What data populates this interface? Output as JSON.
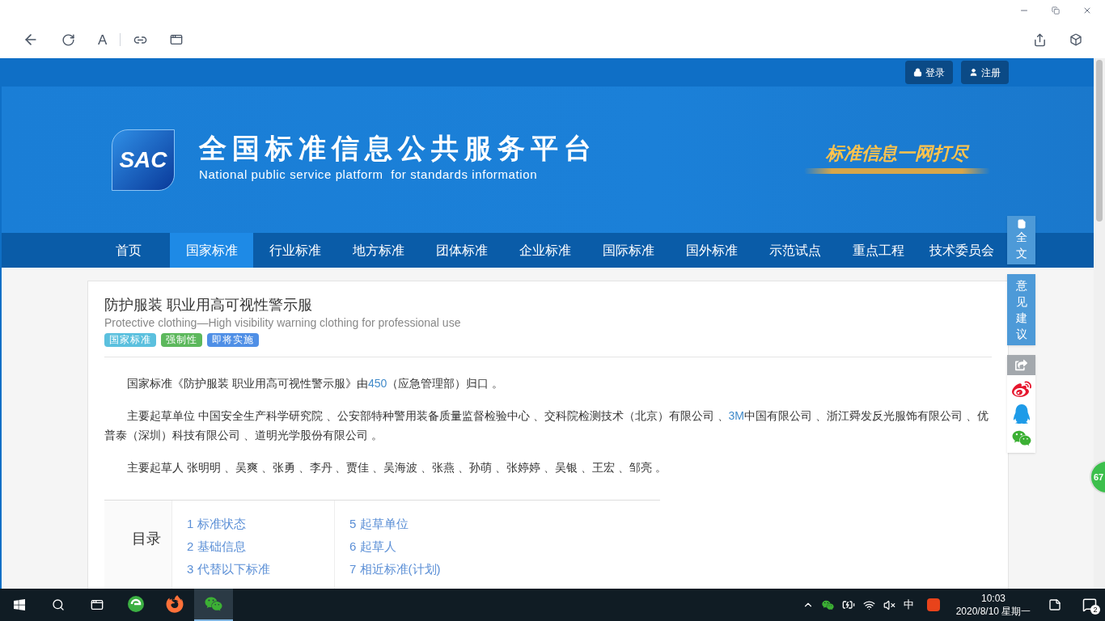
{
  "browser": {
    "font_button": "A"
  },
  "header": {
    "buttons": [
      {
        "kind": "login",
        "label": "登录"
      },
      {
        "kind": "register",
        "label": "注册"
      }
    ]
  },
  "banner": {
    "logo_text": "SAC",
    "title": "全国标准信息公共服务平台",
    "subtitle": "National public service platform  for standards information",
    "slogan": "标准信息一网打尽"
  },
  "nav": [
    {
      "label": "首页",
      "selected": false
    },
    {
      "label": "国家标准",
      "selected": true
    },
    {
      "label": "行业标准",
      "selected": false
    },
    {
      "label": "地方标准",
      "selected": false
    },
    {
      "label": "团体标准",
      "selected": false
    },
    {
      "label": "企业标准",
      "selected": false
    },
    {
      "label": "国际标准",
      "selected": false
    },
    {
      "label": "国外标准",
      "selected": false
    },
    {
      "label": "示范试点",
      "selected": false
    },
    {
      "label": "重点工程",
      "selected": false
    },
    {
      "label": "技术委员会",
      "selected": false
    }
  ],
  "standard": {
    "title": "防护服装 职业用高可视性警示服",
    "english_title": "Protective clothing—High visibility warning clothing for professional use",
    "tags": [
      {
        "label": "国家标准",
        "color": "#5bc0de"
      },
      {
        "label": "强制性",
        "color": "#5cb85c"
      },
      {
        "label": "即将实施",
        "color": "#4f8fe6"
      }
    ],
    "paragraphs": [
      [
        {
          "kind": "text",
          "text": "国家标准《防护服装 职业用高可视性警示服》由"
        },
        {
          "kind": "link",
          "text": "450"
        },
        {
          "kind": "text",
          "text": "（应急管理部）归口 。"
        }
      ],
      [
        {
          "kind": "text",
          "text": "主要起草单位 中国安全生产科学研究院 、公安部特种警用装备质量监督检验中心 、交科院检测技术（北京）有限公司 、"
        },
        {
          "kind": "link",
          "text": "3M"
        },
        {
          "kind": "text",
          "text": "中国有限公司 、浙江舜发反光服饰有限公司 、优普泰（深圳）科技有限公司 、道明光学股份有限公司 。"
        }
      ],
      [
        {
          "kind": "text",
          "text": "主要起草人 张明明 、吴爽 、张勇 、李丹 、贾佳 、吴海波 、张燕 、孙萌 、张婷婷 、吴银 、王宏 、邹亮 。"
        }
      ]
    ],
    "toc": {
      "label": "目录",
      "columns": [
        [
          {
            "number": "1",
            "label": "标准状态"
          },
          {
            "number": "2",
            "label": "基础信息"
          },
          {
            "number": "3",
            "label": "代替以下标准"
          }
        ],
        [
          {
            "number": "5",
            "label": "起草单位"
          },
          {
            "number": "6",
            "label": "起草人"
          },
          {
            "number": "7",
            "label": "相近标准(计划)"
          }
        ]
      ]
    }
  },
  "side_tools": {
    "full_text": "全文",
    "feedback": "意见建议"
  },
  "floating_badge": "67",
  "taskbar": {
    "apps": [
      {
        "kind": "browser",
        "selected": false
      },
      {
        "kind": "firefox",
        "selected": false
      },
      {
        "kind": "wechat",
        "selected": true
      }
    ],
    "ime": "中",
    "time": "10:03",
    "date": "2020/8/10 星期一",
    "notifications": "2"
  }
}
